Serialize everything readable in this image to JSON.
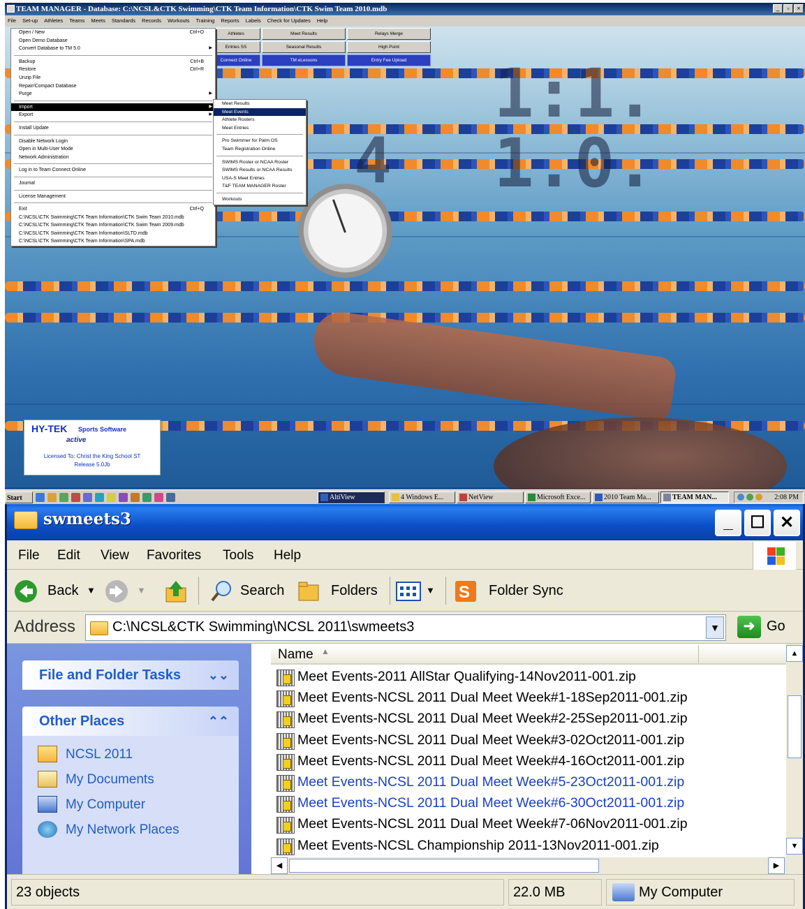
{
  "tm_window": {
    "title": "TEAM MANAGER - Database: C:\\NCSL&CTK Swimming\\CTK Team Information\\CTK Swim Team 2010.mdb",
    "window_buttons": [
      "_",
      "▫",
      "×"
    ],
    "menubar": [
      "File",
      "Set-up",
      "Athletes",
      "Teams",
      "Meets",
      "Standards",
      "Records",
      "Workouts",
      "Training",
      "Reports",
      "Labels",
      "Check for Updates",
      "Help"
    ],
    "quick_buttons": [
      "Athletes",
      "Meet Results",
      "Relays Merge",
      "Entries SS",
      "Seasonal Results",
      "High Point",
      "Connect Online",
      "TM eLessons",
      "Entry Fee Upload"
    ],
    "file_menu": {
      "items": [
        {
          "label": "Open / New",
          "shortcut": "Ctrl+O"
        },
        {
          "label": "Open Demo Database",
          "shortcut": ""
        },
        {
          "label": "Convert Database to TM 5.0",
          "shortcut": "",
          "arrow": "▶"
        },
        {
          "sep": true
        },
        {
          "label": "Backup",
          "shortcut": "Ctrl+B"
        },
        {
          "label": "Restore",
          "shortcut": "Ctrl+R"
        },
        {
          "label": "Unzip File",
          "shortcut": ""
        },
        {
          "label": "Repair/Compact Database",
          "shortcut": ""
        },
        {
          "label": "Purge",
          "shortcut": "",
          "arrow": "▶"
        },
        {
          "sep": true
        },
        {
          "label": "Import",
          "shortcut": "",
          "arrow": "▶",
          "selected": true
        },
        {
          "label": "Export",
          "shortcut": "",
          "arrow": "▶"
        },
        {
          "sep": true
        },
        {
          "label": "Install Update",
          "shortcut": ""
        },
        {
          "sep": true
        },
        {
          "label": "Disable Network Login",
          "shortcut": ""
        },
        {
          "label": "Open in Multi-User Mode",
          "shortcut": ""
        },
        {
          "label": "Network Administration",
          "shortcut": ""
        },
        {
          "sep": true
        },
        {
          "label": "Log in to Team Connect Online",
          "shortcut": ""
        },
        {
          "sep": true
        },
        {
          "label": "Journal",
          "shortcut": ""
        },
        {
          "sep": true
        },
        {
          "label": "License Management",
          "shortcut": ""
        },
        {
          "sep": true
        },
        {
          "label": "Exit",
          "shortcut": "Ctrl+Q"
        },
        {
          "label": "C:\\NCSL\\CTK Swimming\\CTK Team Information\\CTK Swim Team 2010.mdb",
          "shortcut": ""
        },
        {
          "label": "C:\\NCSL\\CTK Swimming\\CTK Team Information\\CTK Swim Team 2009.mdb",
          "shortcut": ""
        },
        {
          "label": "C:\\NCSL\\CTK Swimming\\CTK Team Information\\SLTD.mdb",
          "shortcut": ""
        },
        {
          "label": "C:\\NCSL\\CTK Swimming\\CTK Team Information\\SPA.mdb",
          "shortcut": ""
        }
      ]
    },
    "import_submenu": {
      "items": [
        {
          "label": "Meet Results"
        },
        {
          "label": "Meet Events",
          "selected": true
        },
        {
          "label": "Athlete Rosters"
        },
        {
          "label": "Meet Entries"
        },
        {
          "sep": true
        },
        {
          "label": "Pro Swimmer for Palm OS"
        },
        {
          "label": "Team Registration Online"
        },
        {
          "sep": true
        },
        {
          "label": "SWIMS Roster or NCAA Roster"
        },
        {
          "label": "SWIMS Results or NCAA Results"
        },
        {
          "label": "USA-S Meet Entries"
        },
        {
          "label": "T&F TEAM MANAGER Roster"
        },
        {
          "sep": true
        },
        {
          "label": "Workouts"
        }
      ]
    },
    "hytek": {
      "brand": "HY-TEK",
      "sub": "Sports Software",
      "partner": "active",
      "licensed": "Licensed To:  Christ the King School ST",
      "release": "Release 5.0Jb"
    }
  },
  "taskbar": {
    "start": "Start",
    "tasks": [
      "AltiView",
      "4 Windows E...",
      "NetView",
      "Microsoft Exce...",
      "2010 Team Ma...",
      "TEAM MAN..."
    ],
    "clock": "2:08 PM"
  },
  "explorer": {
    "title": "swmeets3",
    "menu": [
      "File",
      "Edit",
      "View",
      "Favorites",
      "Tools",
      "Help"
    ],
    "toolbar": {
      "back": "Back",
      "search": "Search",
      "folders": "Folders",
      "folder_sync": "Folder Sync"
    },
    "address": {
      "label": "Address",
      "value": "C:\\NCSL&CTK Swimming\\NCSL 2011\\swmeets3",
      "go": "Go"
    },
    "task_pane": {
      "file_tasks_title": "File and Folder Tasks",
      "other_places_title": "Other Places",
      "other_places": [
        "NCSL 2011",
        "My Documents",
        "My Computer",
        "My Network Places"
      ]
    },
    "list": {
      "column_name": "Name",
      "files": [
        "Meet Events-2011 AllStar Qualifying-14Nov2011-001.zip",
        "Meet Events-NCSL 2011 Dual Meet Week#1-18Sep2011-001.zip",
        "Meet Events-NCSL 2011 Dual Meet Week#2-25Sep2011-001.zip",
        "Meet Events-NCSL 2011 Dual Meet Week#3-02Oct2011-001.zip",
        "Meet Events-NCSL 2011 Dual Meet Week#4-16Oct2011-001.zip",
        "Meet Events-NCSL 2011 Dual Meet Week#5-23Oct2011-001.zip",
        "Meet Events-NCSL 2011 Dual Meet Week#6-30Oct2011-001.zip",
        "Meet Events-NCSL 2011 Dual Meet Week#7-06Nov2011-001.zip",
        "Meet Events-NCSL Championship 2011-13Nov2011-001.zip"
      ]
    },
    "status": {
      "objects": "23 objects",
      "size": "22.0 MB",
      "location": "My Computer"
    }
  }
}
